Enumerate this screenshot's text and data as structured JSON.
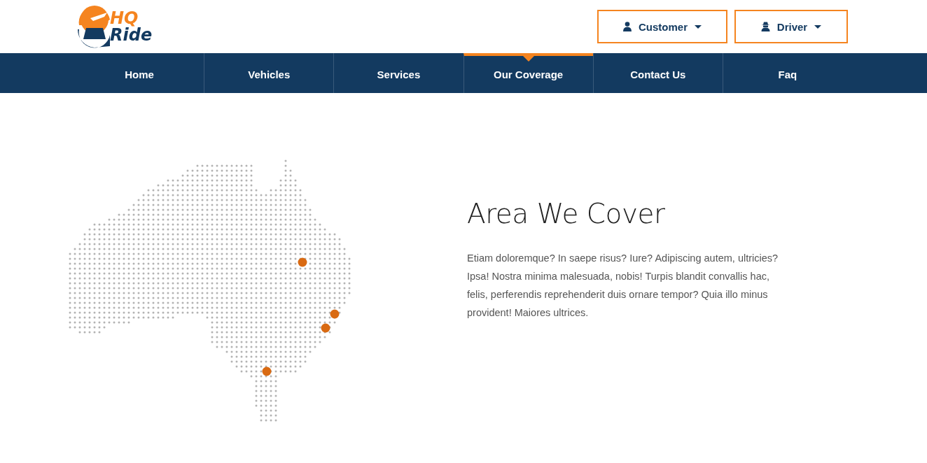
{
  "logo": {
    "line1": "HQ",
    "line2": "Ride"
  },
  "account_menus": [
    {
      "label": "Customer",
      "kind": "customer"
    },
    {
      "label": "Driver",
      "kind": "driver"
    }
  ],
  "nav": [
    {
      "label": "Home",
      "selected": false
    },
    {
      "label": "Vehicles",
      "selected": false
    },
    {
      "label": "Services",
      "selected": false
    },
    {
      "label": "Our Coverage",
      "selected": true
    },
    {
      "label": "Contact Us",
      "selected": false
    },
    {
      "label": "Faq",
      "selected": false
    }
  ],
  "coverage": {
    "heading": "Area We Cover",
    "text": "Etiam doloremque? In saepe risus? Iure? Adipiscing autem, ultricies? Ipsa! Nostra minima malesuada, nobis! Turpis blandit convallis hac, felis, perferendis reprehenderit duis ornare tempor? Quia illo minus provident! Maiores ultrices."
  }
}
